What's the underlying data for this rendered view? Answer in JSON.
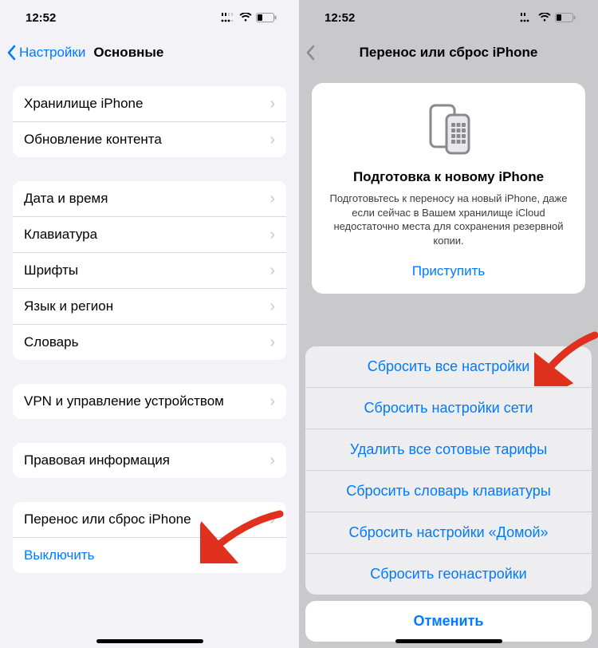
{
  "status": {
    "time": "12:52"
  },
  "left": {
    "back_label": "Настройки",
    "title": "Основные",
    "group1": [
      "Хранилище iPhone",
      "Обновление контента"
    ],
    "group2": [
      "Дата и время",
      "Клавиатура",
      "Шрифты",
      "Язык и регион",
      "Словарь"
    ],
    "group3": [
      "VPN и управление устройством"
    ],
    "group4": [
      "Правовая информация"
    ],
    "group5_row": "Перенос или сброс iPhone",
    "group5_link": "Выключить"
  },
  "right": {
    "title": "Перенос или сброс iPhone",
    "card": {
      "heading": "Подготовка к новому iPhone",
      "body": "Подготовьтесь к переносу на новый iPhone, даже если сейчас в Вашем хранилище iCloud недостаточно места для сохранения резервной копии.",
      "cta": "Приступить"
    },
    "sheet": [
      "Сбросить все настройки",
      "Сбросить настройки сети",
      "Удалить все сотовые тарифы",
      "Сбросить словарь клавиатуры",
      "Сбросить настройки «Домой»",
      "Сбросить геонастройки"
    ],
    "cancel": "Отменить"
  }
}
